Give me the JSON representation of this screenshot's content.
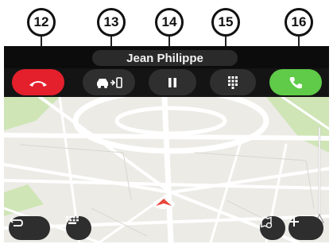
{
  "callouts": [
    "12",
    "13",
    "14",
    "15",
    "16"
  ],
  "call": {
    "caller_name": "Jean Philippe",
    "buttons": [
      {
        "name": "hang-up",
        "icon": "phone-hangup-icon",
        "color": "#e3202c"
      },
      {
        "name": "transfer-to-phone",
        "icon": "car-to-phone-icon"
      },
      {
        "name": "hold",
        "icon": "pause-icon"
      },
      {
        "name": "keypad",
        "icon": "keypad-icon"
      },
      {
        "name": "answer",
        "icon": "phone-icon",
        "color": "#5fcb48"
      }
    ]
  },
  "map_controls": {
    "back": {
      "icon": "back-arrow-icon"
    },
    "keyboard": {
      "icon": "keyboard-icon"
    },
    "view": {
      "icon": "map-view-icon"
    },
    "zoom_in": {
      "icon": "plus-icon"
    }
  },
  "colors": {
    "screen": "#0c0c0c",
    "map": "#ecebe6",
    "green_areas": "#cfe5b6",
    "roads": "#ffffff",
    "position_marker": "#e8463a"
  }
}
